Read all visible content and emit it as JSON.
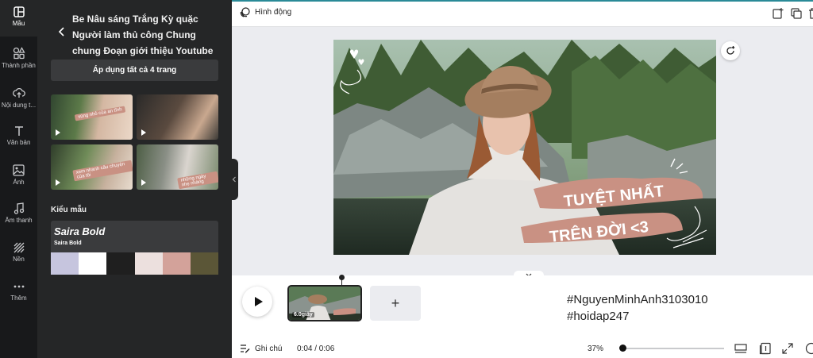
{
  "rail": {
    "items": [
      {
        "label": "Mẫu",
        "icon": "template-icon",
        "active": true
      },
      {
        "label": "Thành phần",
        "icon": "shapes-icon"
      },
      {
        "label": "Nội dung t...",
        "icon": "cloud-upload-icon"
      },
      {
        "label": "Văn bản",
        "icon": "text-icon"
      },
      {
        "label": "Ảnh",
        "icon": "image-icon"
      },
      {
        "label": "Âm thanh",
        "icon": "music-icon"
      },
      {
        "label": "Nền",
        "icon": "background-pattern-icon"
      },
      {
        "label": "Thêm",
        "icon": "more-dots-icon"
      }
    ]
  },
  "panel": {
    "title": "Be Nâu sáng Trắng Kỳ quặc Người làm thủ công Chung chung Đoạn giới thiệu Youtube",
    "apply_label": "Áp dụng tất cả 4 trang",
    "thumbnails": [
      {
        "tag": "vùng nhỏ của an tĩnh"
      },
      {
        "tag": ""
      },
      {
        "tag": "xem nhanh câu chuyện của tôi"
      },
      {
        "tag": "những ngày nhẹ nhàng"
      }
    ],
    "styles_title": "Kiểu mẫu",
    "font_heading": "Saira Bold",
    "font_body": "Saira Bold",
    "palette": [
      "#c6c5de",
      "#ffffff",
      "#1f1f1f",
      "#ece0de",
      "#d3a29a",
      "#5b5637"
    ]
  },
  "topbar": {
    "animate_label": "Hình động",
    "accent": "#2a8a97"
  },
  "canvas": {
    "headline_line1": "TUYỆT NHẤT",
    "headline_line2": "TRÊN ĐỜI <3",
    "brush_color": "#c99183"
  },
  "timeline": {
    "scene_duration": "6.0giây",
    "add_label": "+",
    "watermark_line1": "#NguyenMinhAnh3103010",
    "watermark_line2": "#hoidap247",
    "notes_label": "Ghi chú",
    "time": "0:04 / 0:06",
    "zoom": "37%",
    "zoom_level": 0.0
  }
}
